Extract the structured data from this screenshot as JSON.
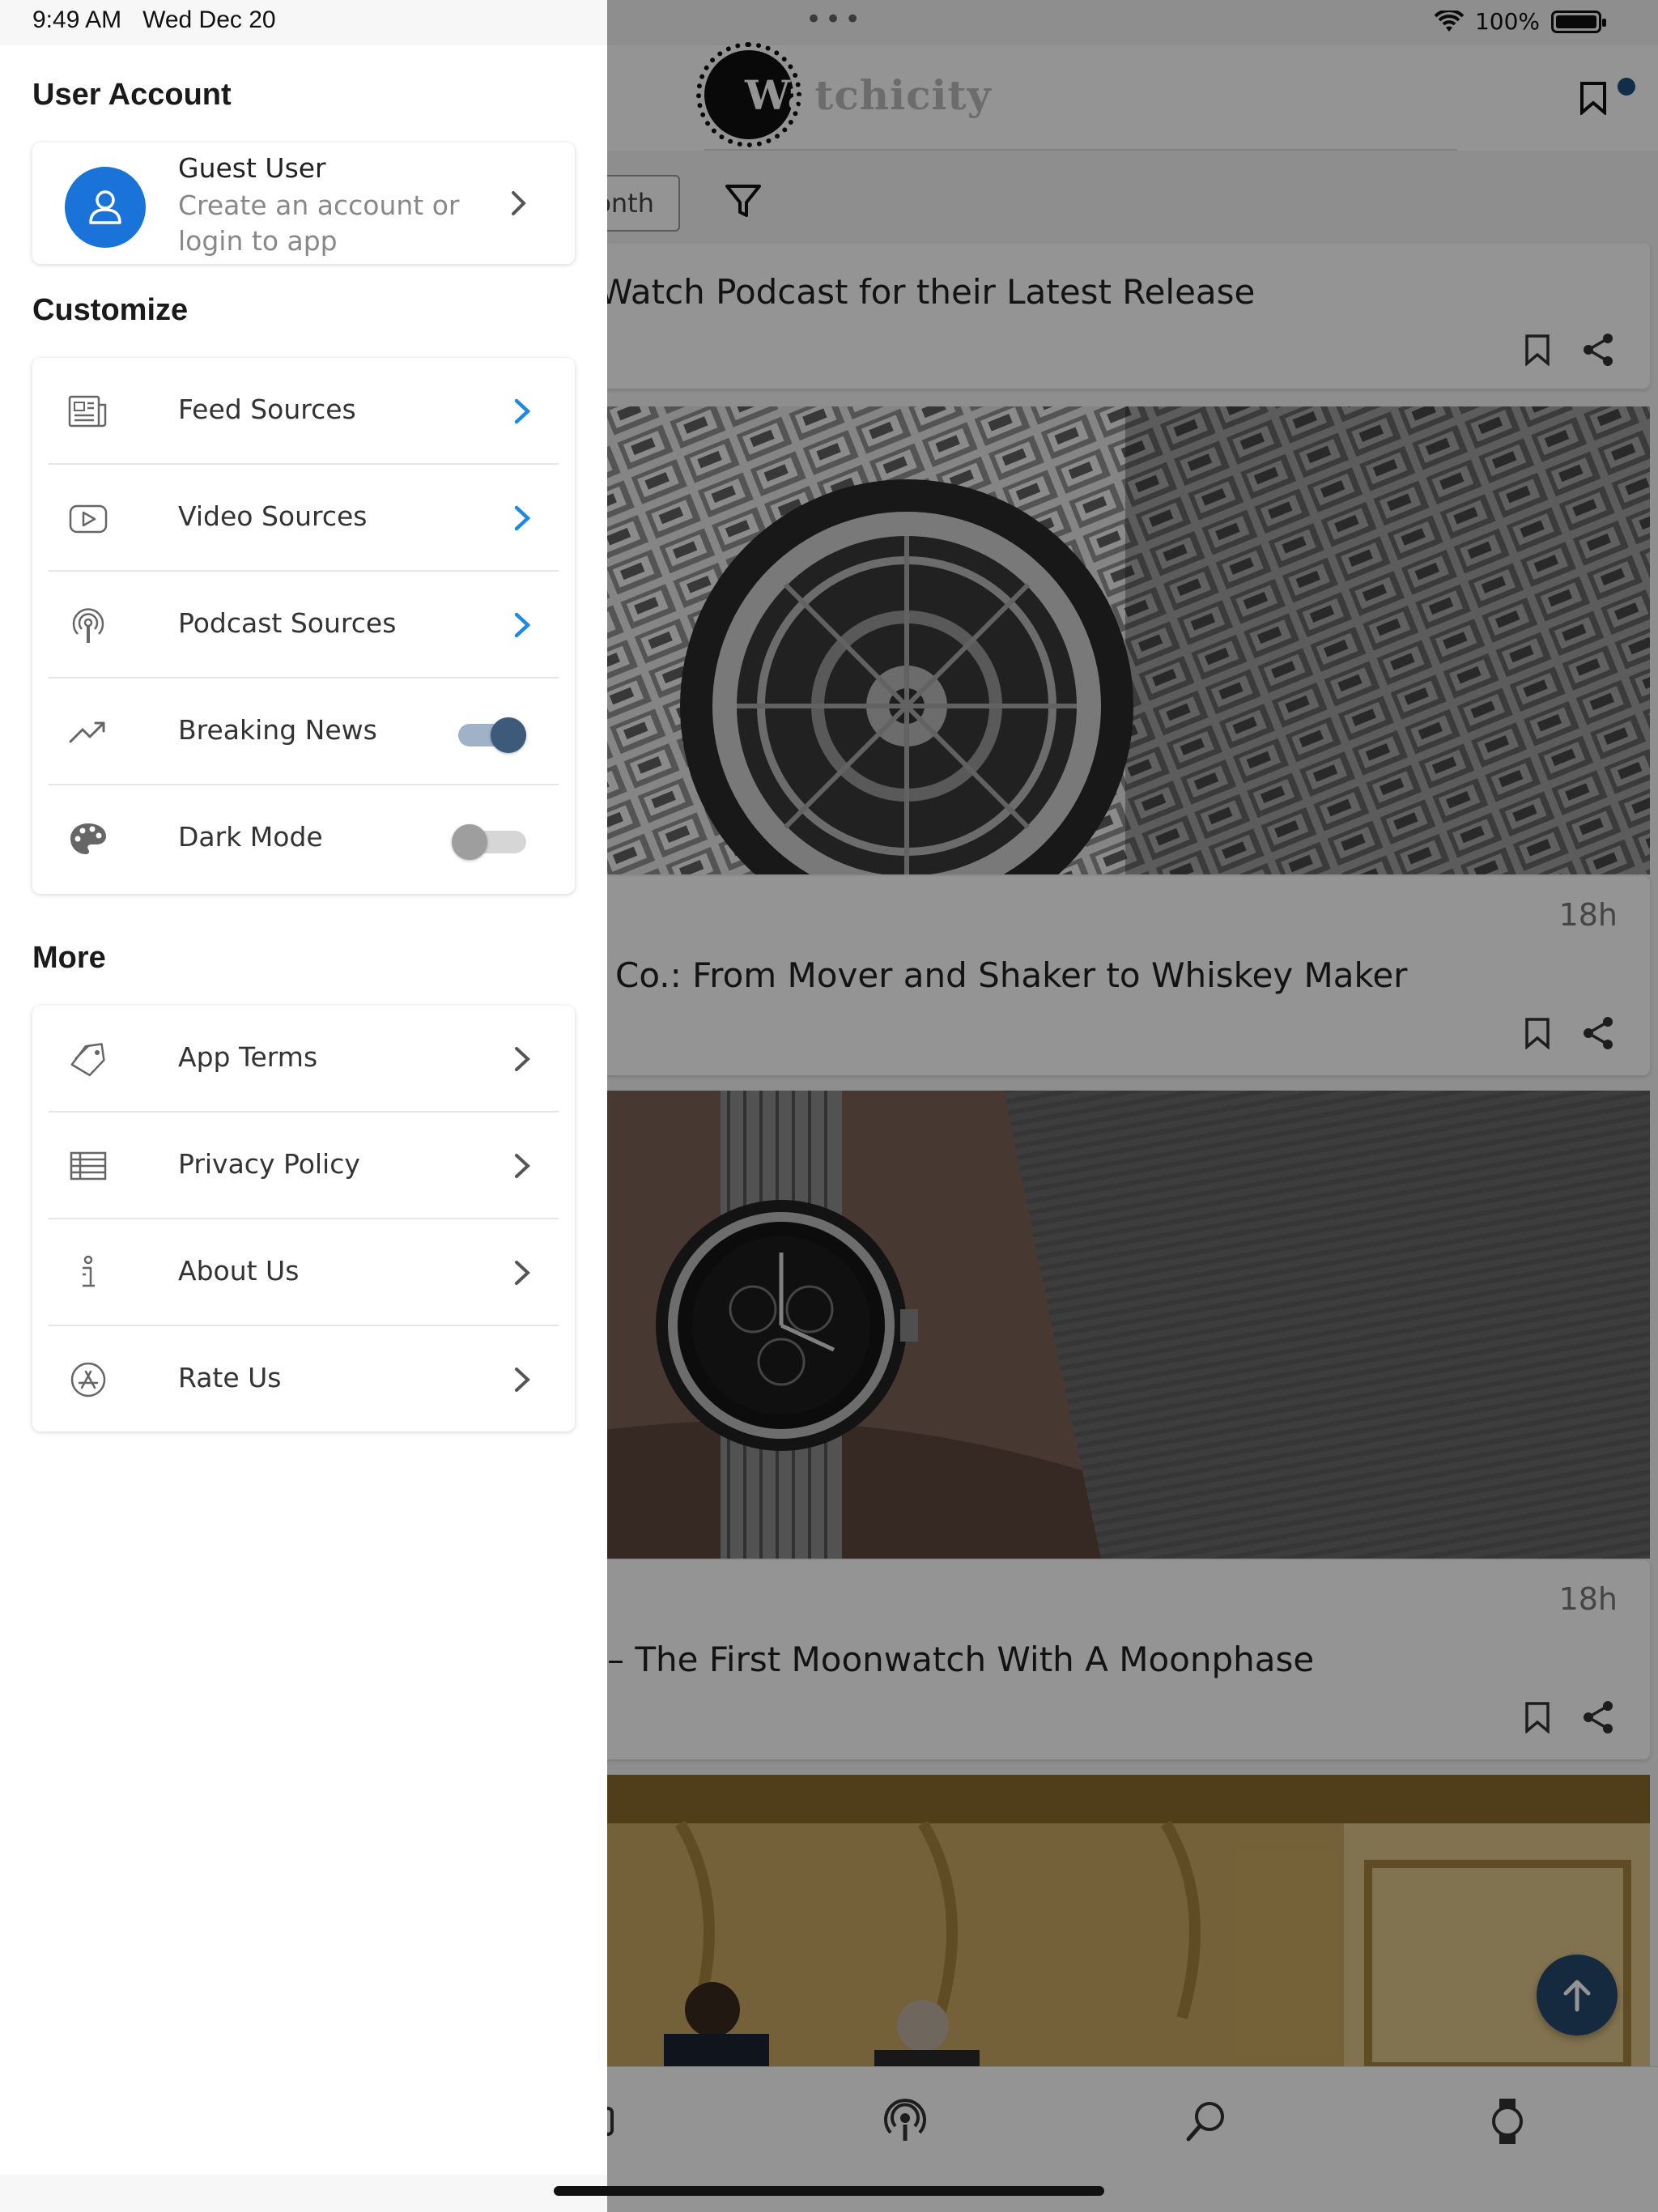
{
  "status_bar": {
    "time": "9:49 AM",
    "date": "Wed Dec 20",
    "battery": "100%"
  },
  "drawer": {
    "user_account_title": "User Account",
    "user": {
      "name": "Guest User",
      "subtitle": "Create an account or login to app"
    },
    "customize_title": "Customize",
    "customize_items": [
      {
        "label": "Feed Sources",
        "icon": "newspaper-icon",
        "control": "chevron"
      },
      {
        "label": "Video Sources",
        "icon": "video-play-icon",
        "control": "chevron"
      },
      {
        "label": "Podcast Sources",
        "icon": "podcast-icon",
        "control": "chevron"
      },
      {
        "label": "Breaking News",
        "icon": "trending-up-icon",
        "control": "toggle",
        "on": true
      },
      {
        "label": "Dark Mode",
        "icon": "palette-icon",
        "control": "toggle",
        "on": false
      }
    ],
    "more_title": "More",
    "more_items": [
      {
        "label": "App Terms",
        "icon": "tag-icon"
      },
      {
        "label": "Privacy Policy",
        "icon": "table-icon"
      },
      {
        "label": "About Us",
        "icon": "info-icon"
      },
      {
        "label": "Rate Us",
        "icon": "app-store-icon"
      }
    ]
  },
  "background": {
    "logo_text": "Watchicity",
    "filter_pill_text": "onth",
    "articles": [
      {
        "title": "Watch Podcast for their Latest Release",
        "time": ""
      },
      {
        "title": "Co.: From Mover and Shaker to Whiskey Maker",
        "time": "18h"
      },
      {
        "title": "– The First Moonwatch With A Moonphase",
        "time": "18h"
      }
    ]
  },
  "colors": {
    "accent_blue": "#1a73d9",
    "chevron_blue": "#1e88e5",
    "toggle_on_knob": "#3d5a7a",
    "toggle_on_track": "#9fb2c7",
    "toggle_off_knob": "#9e9e9e",
    "toggle_off_track": "#d6d6d6"
  }
}
